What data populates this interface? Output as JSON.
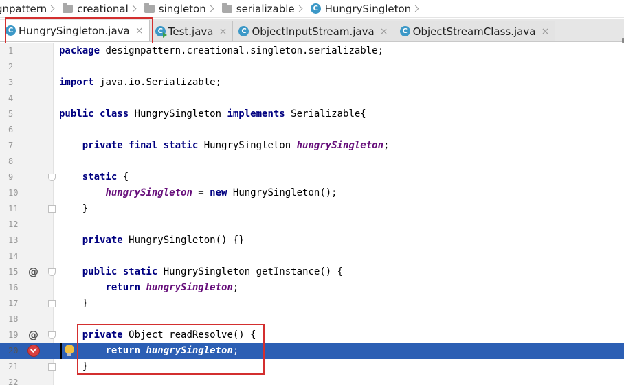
{
  "breadcrumb": {
    "items": [
      {
        "label": "gnpattern",
        "icon": "folder-icon"
      },
      {
        "label": "creational",
        "icon": "folder-icon"
      },
      {
        "label": "singleton",
        "icon": "folder-icon"
      },
      {
        "label": "serializable",
        "icon": "folder-icon"
      },
      {
        "label": "HungrySingleton",
        "icon": "class-icon"
      }
    ]
  },
  "tabs": [
    {
      "label": "HungrySingleton.java",
      "icon": "class-icon",
      "active": true
    },
    {
      "label": "Test.java",
      "icon": "class-icon",
      "active": false
    },
    {
      "label": "ObjectInputStream.java",
      "icon": "class-icon",
      "active": false
    },
    {
      "label": "ObjectStreamClass.java",
      "icon": "class-icon",
      "active": false
    }
  ],
  "tab_icon_letter": "C",
  "close_glyph": "×",
  "gutter_marks": {
    "at": "@"
  },
  "code_lines": [
    {
      "n": "1",
      "tokens": [
        {
          "t": "package ",
          "k": "kw"
        },
        {
          "t": "designpattern.creational.singleton.serializable;",
          "k": ""
        }
      ]
    },
    {
      "n": "2",
      "tokens": []
    },
    {
      "n": "3",
      "tokens": [
        {
          "t": "import ",
          "k": "kw"
        },
        {
          "t": "java.io.Serializable;",
          "k": ""
        }
      ]
    },
    {
      "n": "4",
      "tokens": []
    },
    {
      "n": "5",
      "tokens": [
        {
          "t": "public class ",
          "k": "kw"
        },
        {
          "t": "HungrySingleton ",
          "k": ""
        },
        {
          "t": "implements ",
          "k": "kw"
        },
        {
          "t": "Serializable{",
          "k": ""
        }
      ]
    },
    {
      "n": "6",
      "tokens": []
    },
    {
      "n": "7",
      "tokens": [
        {
          "t": "    ",
          "k": ""
        },
        {
          "t": "private final static ",
          "k": "kw"
        },
        {
          "t": "HungrySingleton ",
          "k": ""
        },
        {
          "t": "hungrySingleton",
          "k": "field"
        },
        {
          "t": ";",
          "k": ""
        }
      ]
    },
    {
      "n": "8",
      "tokens": []
    },
    {
      "n": "9",
      "tokens": [
        {
          "t": "    ",
          "k": ""
        },
        {
          "t": "static ",
          "k": "kw"
        },
        {
          "t": "{",
          "k": ""
        }
      ]
    },
    {
      "n": "10",
      "tokens": [
        {
          "t": "        ",
          "k": ""
        },
        {
          "t": "hungrySingleton",
          "k": "field"
        },
        {
          "t": " = ",
          "k": ""
        },
        {
          "t": "new ",
          "k": "kw"
        },
        {
          "t": "HungrySingleton();",
          "k": ""
        }
      ]
    },
    {
      "n": "11",
      "tokens": [
        {
          "t": "    }",
          "k": ""
        }
      ]
    },
    {
      "n": "12",
      "tokens": []
    },
    {
      "n": "13",
      "tokens": [
        {
          "t": "    ",
          "k": ""
        },
        {
          "t": "private ",
          "k": "kw"
        },
        {
          "t": "HungrySingleton() {}",
          "k": ""
        }
      ]
    },
    {
      "n": "14",
      "tokens": []
    },
    {
      "n": "15",
      "tokens": [
        {
          "t": "    ",
          "k": ""
        },
        {
          "t": "public static ",
          "k": "kw"
        },
        {
          "t": "HungrySingleton getInstance() {",
          "k": ""
        }
      ]
    },
    {
      "n": "16",
      "tokens": [
        {
          "t": "        ",
          "k": ""
        },
        {
          "t": "return ",
          "k": "kw"
        },
        {
          "t": "hungrySingleton",
          "k": "field"
        },
        {
          "t": ";",
          "k": ""
        }
      ]
    },
    {
      "n": "17",
      "tokens": [
        {
          "t": "    }",
          "k": ""
        }
      ]
    },
    {
      "n": "18",
      "tokens": []
    },
    {
      "n": "19",
      "tokens": [
        {
          "t": "    ",
          "k": ""
        },
        {
          "t": "private ",
          "k": "kw"
        },
        {
          "t": "Object readResolve() {",
          "k": ""
        }
      ]
    },
    {
      "n": "20",
      "tokens": [
        {
          "t": "        ",
          "k": ""
        },
        {
          "t": "return ",
          "k": "kw"
        },
        {
          "t": "hungrySingleton",
          "k": "field"
        },
        {
          "t": ";",
          "k": ""
        }
      ]
    },
    {
      "n": "21",
      "tokens": [
        {
          "t": "    }",
          "k": ""
        }
      ]
    },
    {
      "n": "22",
      "tokens": []
    }
  ],
  "current_line": "20",
  "colors": {
    "keyword": "#000080",
    "field": "#660e7a",
    "current_line_bg": "#2c5fb4",
    "highlight_box": "#d32f2f",
    "class_icon": "#3c98c7"
  }
}
